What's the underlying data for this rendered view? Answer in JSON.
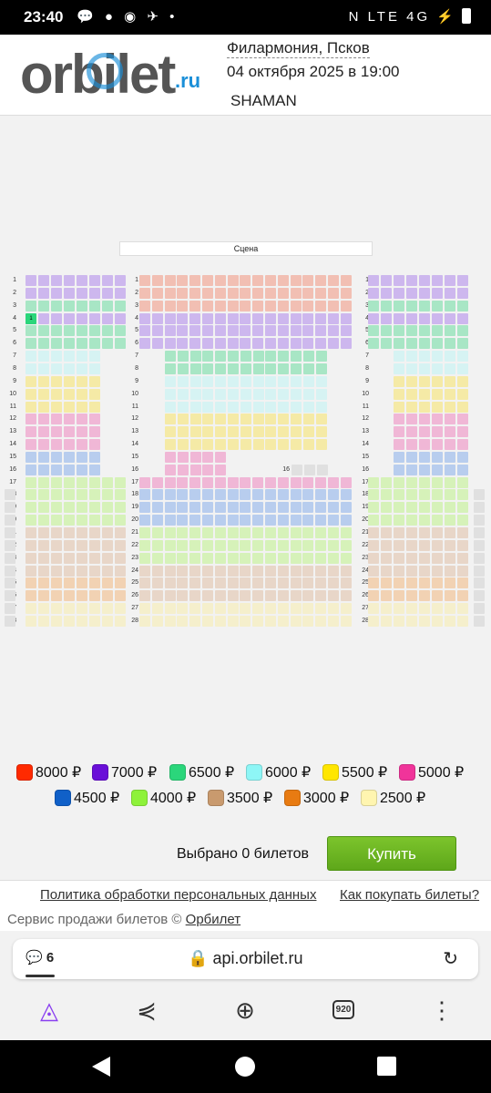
{
  "status_bar": {
    "time": "23:40",
    "notif_icons": "💬 ● ◉ ✈ •",
    "right_icons": "N LTE 4G ⚡"
  },
  "header": {
    "logo": "orbilet",
    "logo_suffix": ".ru",
    "venue": "Филармония, Псков",
    "datetime": "04 октября 2025 в 19:00",
    "event": "SHAMAN"
  },
  "hall": {
    "stage_label": "Сцена",
    "selected_seat_label": "1",
    "row_labels": [
      "1",
      "2",
      "3",
      "4",
      "5",
      "6",
      "7",
      "8",
      "9",
      "10",
      "11",
      "12",
      "13",
      "14",
      "15",
      "16",
      "17",
      "18",
      "19",
      "20",
      "21",
      "22",
      "23",
      "24",
      "25",
      "26",
      "27",
      "28"
    ],
    "center_row16_label": "16"
  },
  "legend": [
    {
      "price": "8000 ₽",
      "color": "#ff2a00"
    },
    {
      "price": "7000 ₽",
      "color": "#6a0fd8"
    },
    {
      "price": "6500 ₽",
      "color": "#2bd67b"
    },
    {
      "price": "6000 ₽",
      "color": "#8ef6f6"
    },
    {
      "price": "5500 ₽",
      "color": "#ffe600"
    },
    {
      "price": "5000 ₽",
      "color": "#f0349a"
    },
    {
      "price": "4500 ₽",
      "color": "#1060c8"
    },
    {
      "price": "4000 ₽",
      "color": "#8ef23a"
    },
    {
      "price": "3500 ₽",
      "color": "#c99a6e"
    },
    {
      "price": "3000 ₽",
      "color": "#e87b12"
    },
    {
      "price": "2500 ₽",
      "color": "#fff5b0"
    }
  ],
  "cart": {
    "selected_text": "Выбрано 0 билетов",
    "buy_label": "Купить"
  },
  "footer": {
    "privacy_link": "Политика обработки персональных данных",
    "howto_link": "Как покупать билеты?",
    "service_prefix": "Сервис продажи билетов ©",
    "service_link": "Орбилет"
  },
  "browser": {
    "tab_count": "6",
    "url": "api.orbilet.ru",
    "tab_counter_badge": "920"
  }
}
